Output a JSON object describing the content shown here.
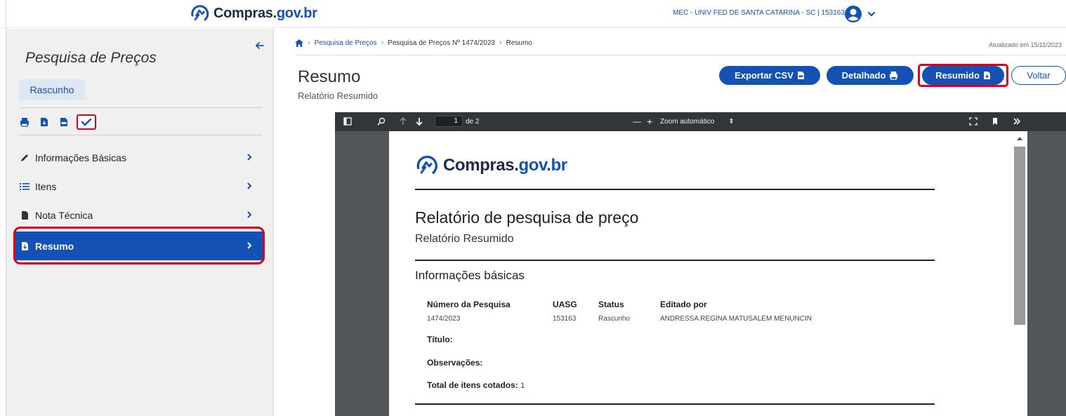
{
  "header": {
    "logo_part1": "Compras.",
    "logo_part2": "gov.br",
    "org": "MEC - UNIV FED DE SANTA CATARINA - SC | 153163"
  },
  "sidebar": {
    "title": "Pesquisa de Preços",
    "status_badge": "Rascunho",
    "items": [
      {
        "label": "Informações Básicas",
        "icon": "pencil-icon"
      },
      {
        "label": "Itens",
        "icon": "list-icon"
      },
      {
        "label": "Nota Técnica",
        "icon": "file-icon"
      },
      {
        "label": "Resumo",
        "icon": "file-download-icon"
      }
    ]
  },
  "breadcrumb": {
    "item1": "Pesquisa de Preços",
    "item2": "Pesquisa de Preços Nº 1474/2023",
    "item3": "Resumo"
  },
  "main": {
    "updated": "Atualizado em 15/11/2023",
    "title": "Resumo",
    "subtitle": "Relatório Resumido",
    "buttons": {
      "export_csv": "Exportar CSV",
      "detalhado": "Detalhado",
      "resumido": "Resumido",
      "voltar": "Voltar"
    }
  },
  "pdf_viewer": {
    "page_number": "1",
    "page_total": "de 2",
    "zoom": "Zoom automático",
    "minus": "—",
    "plus": "+"
  },
  "pdf_page": {
    "logo_part1": "Compras.",
    "logo_part2": "gov.br",
    "title": "Relatório de pesquisa de preço",
    "subtitle": "Relatório Resumido",
    "section": "Informações básicas",
    "columns": [
      {
        "header": "Número da Pesquisa",
        "value": "1474/2023"
      },
      {
        "header": "UASG",
        "value": "153163"
      },
      {
        "header": "Status",
        "value": "Rascunho"
      },
      {
        "header": "Editado por",
        "value": "ANDRESSA REGINA MATUSALEM MENUNCIN"
      }
    ],
    "titulo_label": "Título:",
    "observacoes_label": "Observações:",
    "total_label": "Total de itens cotados:",
    "total_value": "1"
  },
  "colors": {
    "primary": "#1351b4",
    "highlight": "#e0001b",
    "sidebar_bg": "#f0f0f0"
  }
}
